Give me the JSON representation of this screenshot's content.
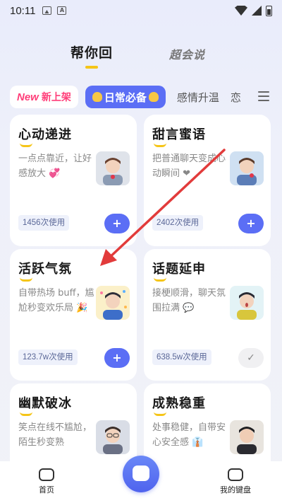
{
  "status_bar": {
    "time": "10:11"
  },
  "top_tabs": [
    {
      "label": "帮你回",
      "active": true
    },
    {
      "label": "超会说",
      "active": false
    }
  ],
  "categories": {
    "new_word": "New",
    "new_label": "新上架",
    "active": "日常必备",
    "items": [
      "感情升温",
      "恋"
    ]
  },
  "cards": [
    {
      "title": "心动递进",
      "desc": "一点点靠近，让好感放大 💞",
      "count": "1456次使用",
      "action": "add",
      "avatar": "boy-red-heart"
    },
    {
      "title": "甜言蜜语",
      "desc": "把普通聊天变成心动瞬间 ❤",
      "count": "2402次使用",
      "action": "add",
      "avatar": "boy-blue-heart"
    },
    {
      "title": "活跃气氛",
      "desc": "自带热场 buff，尴尬秒变欢乐局 🎉",
      "count": "123.7w次使用",
      "action": "add",
      "avatar": "boy-party"
    },
    {
      "title": "话题延申",
      "desc": "接梗顺滑，聊天氛围拉满 💬",
      "count": "638.5w次使用",
      "action": "added",
      "avatar": "boy-surprised"
    },
    {
      "title": "幽默破冰",
      "desc": "笑点在线不尴尬，陌生秒变熟",
      "count": "",
      "action": "add",
      "avatar": "boy-glasses"
    },
    {
      "title": "成熟稳重",
      "desc": "处事稳健，自带安心安全感 👔",
      "count": "",
      "action": "add",
      "avatar": "man-suit"
    }
  ],
  "bottom_nav": {
    "home": "首页",
    "keyboard": "我的键盘"
  },
  "colors": {
    "accent": "#5b6ef5",
    "highlight": "#f5c518",
    "new_pink": "#ff3e79",
    "arrow_red": "#e23b3b"
  }
}
